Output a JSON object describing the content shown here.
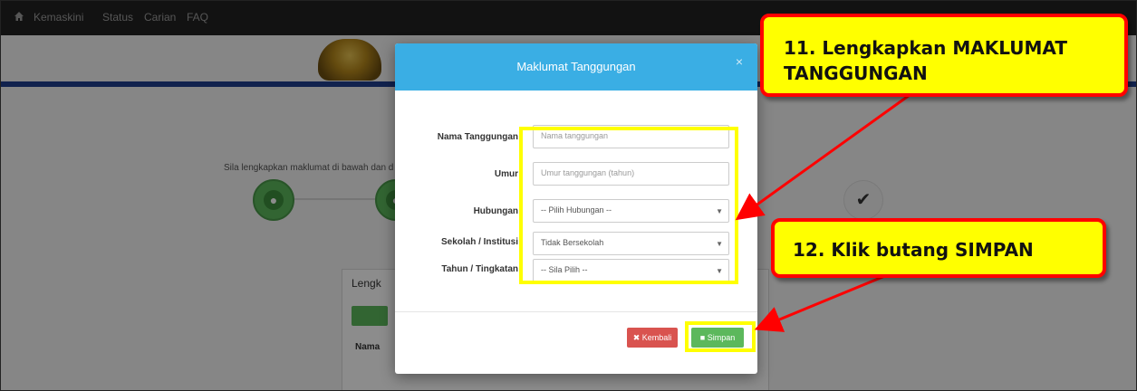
{
  "nav": {
    "items": [
      "Kemaskini",
      "Status",
      "Carian",
      "FAQ"
    ]
  },
  "page": {
    "intro_text": "Sila lengkapkan maklumat di bawah dan d",
    "panel_title": "Lengk",
    "panel_column": "Nama"
  },
  "modal": {
    "title": "Maklumat Tanggungan",
    "close": "×",
    "fields": [
      {
        "label": "Nama Tanggungan",
        "placeholder": "Nama tanggungan"
      },
      {
        "label": "Umur",
        "placeholder": "Umur tanggungan (tahun)"
      },
      {
        "label": "Hubungan",
        "value": "-- Pilih Hubungan --"
      },
      {
        "label": "Sekolah / Institusi",
        "value": "Tidak Bersekolah"
      },
      {
        "label": "Tahun / Tingkatan",
        "value": "-- Sila Pilih --"
      }
    ],
    "kembali_label": "Kembali",
    "simpan_label": "Simpan"
  },
  "callouts": {
    "step11": "11. Lengkapkan MAKLUMAT TANGGUNGAN",
    "step12": "12. Klik butang SIMPAN"
  },
  "colors": {
    "header_blue": "#3aaee4",
    "highlight": "#ffff00",
    "callout_border": "#ff0000",
    "success": "#5cb85c",
    "danger": "#d9534f"
  }
}
